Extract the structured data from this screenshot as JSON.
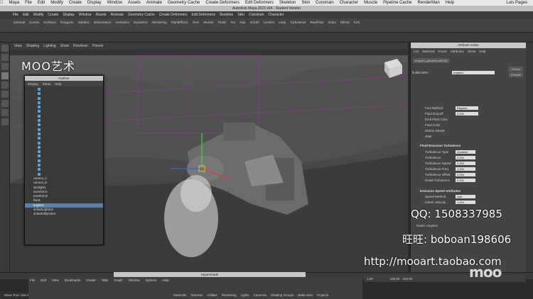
{
  "mac_menu": {
    "items": [
      "Maya",
      "File",
      "Edit",
      "Modify",
      "Create",
      "Display",
      "Window",
      "Assets",
      "Animate",
      "Geometry Cache",
      "Create Deformers",
      "Edit Deformers",
      "Skeleton",
      "Skin",
      "Constrain",
      "Character",
      "Muscle",
      "Pipeline Cache",
      "RenderMan",
      "Help"
    ],
    "clock": "Luis Pages"
  },
  "window_title": "Autodesk Maya 2015 x64 - Student Version",
  "shelf_tabs": [
    "General",
    "Curves",
    "Surfaces",
    "Polygons",
    "Subdivs",
    "Deformation",
    "Animation",
    "Dynamics",
    "Rendering",
    "PaintEffects",
    "Toon",
    "Muscle",
    "Fluids",
    "Fur",
    "Hair",
    "nCloth",
    "Custom",
    "Leap",
    "Turbulence",
    "RealFlow",
    "XGen",
    "Bifrost",
    "Kick"
  ],
  "viewport_menu": [
    "View",
    "Shading",
    "Lighting",
    "Show",
    "Renderer",
    "Panels"
  ],
  "watermarks": {
    "top_left": "MOO艺术",
    "qq": "QQ: 1508337985",
    "wangwang": "旺旺: boboan198606",
    "url": "http://mooart.taobao.com",
    "brand": "moo"
  },
  "outliner": {
    "title": "Outliner",
    "menu": [
      "Display",
      "Show",
      "Help"
    ],
    "dim_rows": 20,
    "rows": [
      "camera_A",
      "camera_B",
      "spotlight1",
      "transform1",
      "transform2",
      "fluid1",
      "engine1",
      "defaultLightSet",
      "defaultObjectSet"
    ],
    "selected": "engine1"
  },
  "attribute_editor": {
    "title": "Attribute Editor",
    "menu": [
      "List",
      "Selected",
      "Focus",
      "Attributes",
      "Show",
      "Help"
    ],
    "tab": "engine1_pieceGrowEmit1",
    "fluid_emitter_label": "fluidEmitter:",
    "fluid_emitter_value": "engine1",
    "focus_btn": "Focus",
    "presets_btn": "Presets",
    "fields": [
      {
        "label": "Fuel Method",
        "value": "Replace"
      },
      {
        "label": "Fluid Dropoff",
        "value": "0.000"
      },
      {
        "label": "Emit Fluid Color",
        "value": ""
      },
      {
        "label": "Fluid Color",
        "value": ""
      },
      {
        "label": "Motion Streak",
        "value": ""
      },
      {
        "label": "Jitter",
        "value": ""
      }
    ],
    "section": "Fluid Emission Turbulence",
    "turbulence": [
      {
        "label": "Turbulence Type",
        "value": "Gradient"
      },
      {
        "label": "Turbulence",
        "value": "0.000"
      },
      {
        "label": "Turbulence Speed",
        "value": "0.200"
      },
      {
        "label": "Turbulence Freq",
        "value": "1.000"
      },
      {
        "label": "Turbulence Offset",
        "value": "0.000"
      },
      {
        "label": "Detail Turbulence",
        "value": "0.000"
      }
    ],
    "section2": "Emission Speed Attributes",
    "speed": [
      {
        "label": "Speed Method",
        "value": "Add"
      },
      {
        "label": "Inherit Velocity",
        "value": "1.000"
      }
    ],
    "notes": "Notes: engine1"
  },
  "hypershade": {
    "title": "Hypershade",
    "menu": [
      "File",
      "Edit",
      "View",
      "Bookmarks",
      "Create",
      "Tabs",
      "Graph",
      "Window",
      "Options",
      "Help"
    ],
    "tabs": [
      "Materials",
      "Textures",
      "Utilities",
      "Rendering",
      "Lights",
      "Cameras",
      "Shading Groups",
      "Bake Sets",
      "Projects"
    ]
  },
  "range": {
    "start": "1.00",
    "end": "240.00",
    "end2": "240.00"
  },
  "status": "Move Tool: Use manipulator to move object(s)."
}
